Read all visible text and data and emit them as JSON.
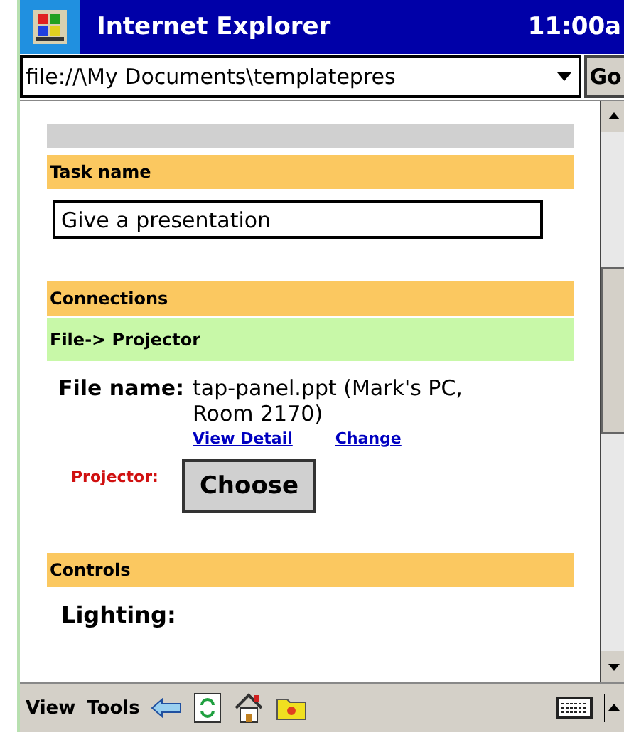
{
  "window": {
    "title": "Internet Explorer",
    "time": "11:00a"
  },
  "address_bar": {
    "value": "file://\\My Documents\\templatepres",
    "go": "Go"
  },
  "sections": [
    {
      "kind": "header",
      "label": "Task name"
    },
    {
      "kind": "field",
      "value": "Give a presentation"
    },
    {
      "kind": "header",
      "label": "Connections"
    },
    {
      "kind": "subheader",
      "label": "File-> Projector"
    },
    {
      "kind": "file",
      "label": "File name:",
      "value": "tap-panel.ppt (Mark's PC, Room 2170)",
      "links": [
        "View Detail",
        "Change"
      ]
    },
    {
      "kind": "chooser",
      "label": "Projector:",
      "button": "Choose"
    },
    {
      "kind": "header",
      "label": "Controls"
    },
    {
      "kind": "item",
      "label": "Lighting:"
    }
  ],
  "toolbar": {
    "menus": [
      "View",
      "Tools"
    ]
  }
}
